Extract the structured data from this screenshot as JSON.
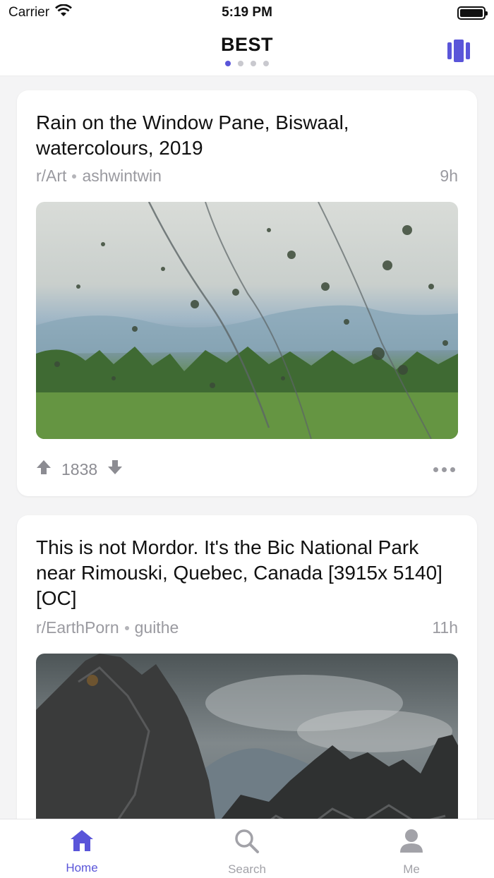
{
  "status_bar": {
    "carrier": "Carrier",
    "time": "5:19 PM"
  },
  "header": {
    "title": "BEST",
    "page_count": 4,
    "active_page": 1,
    "accent_color": "#5a55d9"
  },
  "posts": [
    {
      "title": "Rain on the Window Pane, Biswaal, watercolours, 2019",
      "subreddit": "r/Art",
      "author": "ashwintwin",
      "age": "9h",
      "score": "1838",
      "image": "watercolour painting of raindrops on a window over a green landscape"
    },
    {
      "title": "This is not Mordor. It's the Bic National Park near Rimouski, Quebec, Canada [3915x 5140] [OC]",
      "subreddit": "r/EarthPorn",
      "author": "guithe",
      "age": "11h",
      "image": "dark jagged rocks under a stormy cloudy sky"
    }
  ],
  "tabs": [
    {
      "label": "Home",
      "icon": "home-icon",
      "active": true
    },
    {
      "label": "Search",
      "icon": "search-icon",
      "active": false
    },
    {
      "label": "Me",
      "icon": "person-icon",
      "active": false
    }
  ]
}
